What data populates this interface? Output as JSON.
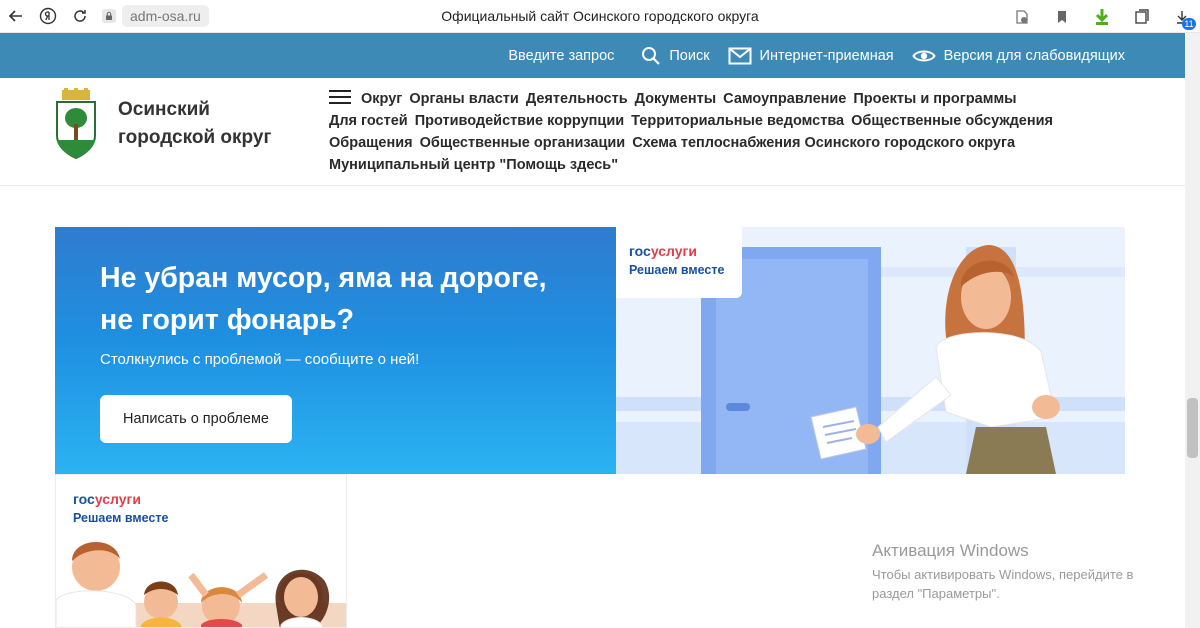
{
  "browser": {
    "url_domain": "adm-osa.ru",
    "tab_title": "Официальный сайт Осинского городского округа",
    "downloads_badge": "11"
  },
  "topbar": {
    "search_placeholder": "Введите запрос",
    "search_label": "Поиск",
    "reception_label": "Интернет-приемная",
    "accessibility_label": "Версия для слабовидящих"
  },
  "header": {
    "site_name_line1": "Осинский",
    "site_name_line2": "городской округ",
    "menu": [
      "Округ",
      "Органы власти",
      "Деятельность",
      "Документы",
      "Самоуправление",
      "Проекты и программы",
      "Для гостей",
      "Противодействие коррупции",
      "Территориальные ведомства",
      "Общественные обсуждения",
      "Обращения",
      "Общественные организации",
      "Схема теплоснабжения Осинского городского округа",
      "Муниципальный центр \"Помощь здесь\""
    ]
  },
  "banner": {
    "title": "Не убран мусор, яма на дороге, не горит фонарь?",
    "subtitle": "Столкнулись с проблемой — сообщите о ней!",
    "button_label": "Написать о проблеме",
    "logo_part1": "гос",
    "logo_part2": "услуги",
    "slogan": "Решаем вместе"
  },
  "card": {
    "logo_part1": "гос",
    "logo_part2": "услуги",
    "slogan": "Решаем вместе"
  },
  "windows_activation": {
    "title": "Активация Windows",
    "text": "Чтобы активировать Windows, перейдите в раздел \"Параметры\"."
  },
  "colors": {
    "topbar_bg": "#3e8ab7",
    "banner_gradient_top": "#2f7ccf",
    "banner_gradient_bottom": "#2bb3f2",
    "gos_blue": "#1a4fa0",
    "gos_red": "#e33d4a"
  }
}
